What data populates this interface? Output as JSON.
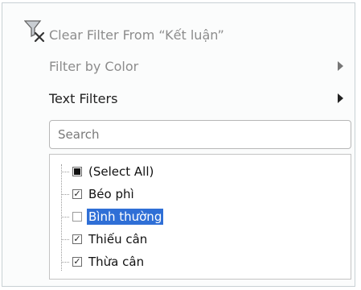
{
  "menu": {
    "clear_filter_label": "Clear Filter From “Kết luận”",
    "filter_by_color_label": "Filter by Color",
    "text_filters_label": "Text Filters"
  },
  "search": {
    "placeholder": "Search"
  },
  "list": {
    "items": [
      {
        "label": "(Select All)",
        "state": "indeterminate"
      },
      {
        "label": "Béo phì",
        "state": "checked"
      },
      {
        "label": "Bình thường",
        "state": "unchecked"
      },
      {
        "label": "Thiếu cân",
        "state": "checked"
      },
      {
        "label": "Thừa cân",
        "state": "checked"
      }
    ]
  },
  "colors": {
    "selection_highlight": "#2f6fd6",
    "panel_border": "#c8d0d4"
  },
  "icons": {
    "clear_filter": "filter-clear-icon",
    "submenu_arrow": "chevron-right-icon"
  }
}
